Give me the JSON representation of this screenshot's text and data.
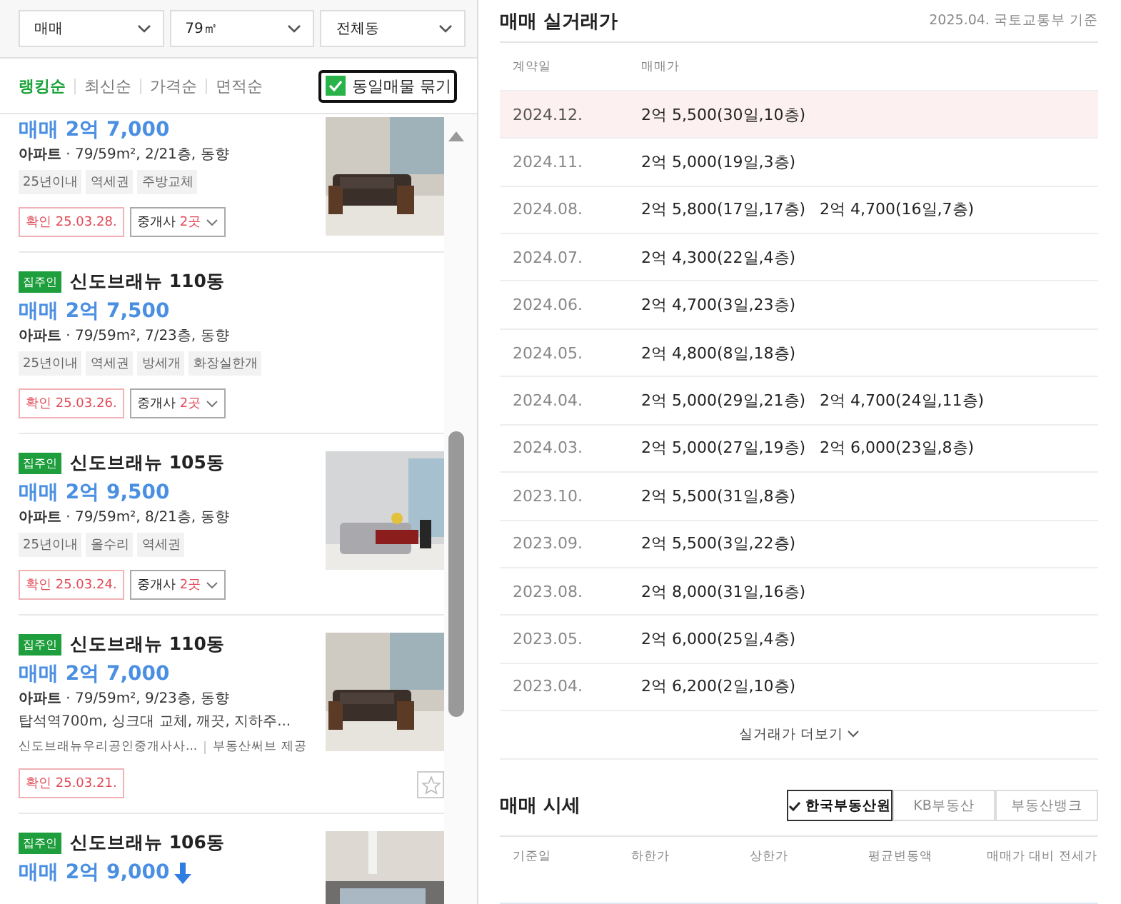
{
  "filters": [
    {
      "label": "매매"
    },
    {
      "label": "79㎡"
    },
    {
      "label": "전체동"
    }
  ],
  "sort_tabs": [
    {
      "label": "랭킹순",
      "selected": true
    },
    {
      "label": "최신순",
      "selected": false
    },
    {
      "label": "가격순",
      "selected": false
    },
    {
      "label": "면적순",
      "selected": false
    }
  ],
  "group_same": {
    "label": "동일매물 묶기",
    "checked": true
  },
  "listings": [
    {
      "price": "매매 2억 7,000",
      "price_down": false,
      "specs": "**아파트** · 79/59m², 2/21층, 동향",
      "tags": [
        "25년이내",
        "역세권",
        "주방교체"
      ],
      "confirm": "확인 25.03.28.",
      "broker": {
        "label": "중개사",
        "count": "2곳"
      },
      "photo": {
        "kind": "picture"
      }
    },
    {
      "badge": "집주인",
      "title": "신도브래뉴 110동",
      "price": "매매 2억 7,500",
      "price_down": false,
      "specs": "**아파트** · 79/59m², 7/23층, 동향",
      "tags": [
        "25년이내",
        "역세권",
        "방세개",
        "화장실한개"
      ],
      "confirm": "확인 25.03.26.",
      "broker": {
        "label": "중개사",
        "count": "2곳"
      }
    },
    {
      "badge": "집주인",
      "title": "신도브래뉴 105동",
      "price": "매매 2억 9,500",
      "price_down": false,
      "specs": "**아파트** · 79/59m², 8/21층, 동향",
      "tags": [
        "25년이내",
        "올수리",
        "역세권"
      ],
      "confirm": "확인 25.03.24.",
      "broker": {
        "label": "중개사",
        "count": "2곳"
      },
      "photo": {
        "kind": "picture"
      }
    },
    {
      "badge": "집주인",
      "title": "신도브래뉴 110동",
      "price": "매매 2억 7,000",
      "price_down": false,
      "specs": "**아파트** · 79/59m², 9/23층, 동향",
      "description": "탑석역700m, 싱크대 교체, 깨끗, 지하주...",
      "agency": "신도브래뉴우리공인중개사사...",
      "provider": "부동산써브 제공",
      "confirm": "확인 25.03.21.",
      "favorite": false,
      "photo": {
        "kind": "picture"
      }
    },
    {
      "badge": "집주인",
      "title": "신도브래뉴 106동",
      "price": "매매 2억 9,000",
      "price_down": true,
      "photo": {
        "kind": "picture"
      }
    }
  ],
  "trade": {
    "title": "매매 실거래가",
    "source": "2025.04. 국토교통부 기준",
    "columns": [
      "계약일",
      "매매가"
    ],
    "rows": [
      {
        "date": "2024.12.",
        "prices": [
          "2억 5,500(30일,10층)"
        ],
        "selected": true
      },
      {
        "date": "2024.11.",
        "prices": [
          "2억 5,000(19일,3층)"
        ],
        "selected": false
      },
      {
        "date": "2024.08.",
        "prices": [
          "2억 5,800(17일,17층)",
          "2억 4,700(16일,7층)"
        ],
        "selected": false
      },
      {
        "date": "2024.07.",
        "prices": [
          "2억 4,300(22일,4층)"
        ],
        "selected": false
      },
      {
        "date": "2024.06.",
        "prices": [
          "2억 4,700(3일,23층)"
        ],
        "selected": false
      },
      {
        "date": "2024.05.",
        "prices": [
          "2억 4,800(8일,18층)"
        ],
        "selected": false
      },
      {
        "date": "2024.04.",
        "prices": [
          "2억 5,000(29일,21층)",
          "2억 4,700(24일,11층)"
        ],
        "selected": false
      },
      {
        "date": "2024.03.",
        "prices": [
          "2억 5,000(27일,19층)",
          "2억 6,000(23일,8층)"
        ],
        "selected": false
      },
      {
        "date": "2023.10.",
        "prices": [
          "2억 5,500(31일,8층)"
        ],
        "selected": false
      },
      {
        "date": "2023.09.",
        "prices": [
          "2억 5,500(3일,22층)"
        ],
        "selected": false
      },
      {
        "date": "2023.08.",
        "prices": [
          "2억 8,000(31일,16층)"
        ],
        "selected": false
      },
      {
        "date": "2023.05.",
        "prices": [
          "2억 6,000(25일,4층)"
        ],
        "selected": false
      },
      {
        "date": "2023.04.",
        "prices": [
          "2억 6,200(2일,10층)"
        ],
        "selected": false
      }
    ],
    "more": "실거래가 더보기"
  },
  "market": {
    "title": "매매 시세",
    "sources": [
      {
        "label": "한국부동산원",
        "selected": true
      },
      {
        "label": "KB부동산",
        "selected": false
      },
      {
        "label": "부동산뱅크",
        "selected": false
      }
    ],
    "columns": [
      "기준일",
      "하한가",
      "상한가",
      "평균변동액",
      "매매가 대비 전세가"
    ]
  }
}
